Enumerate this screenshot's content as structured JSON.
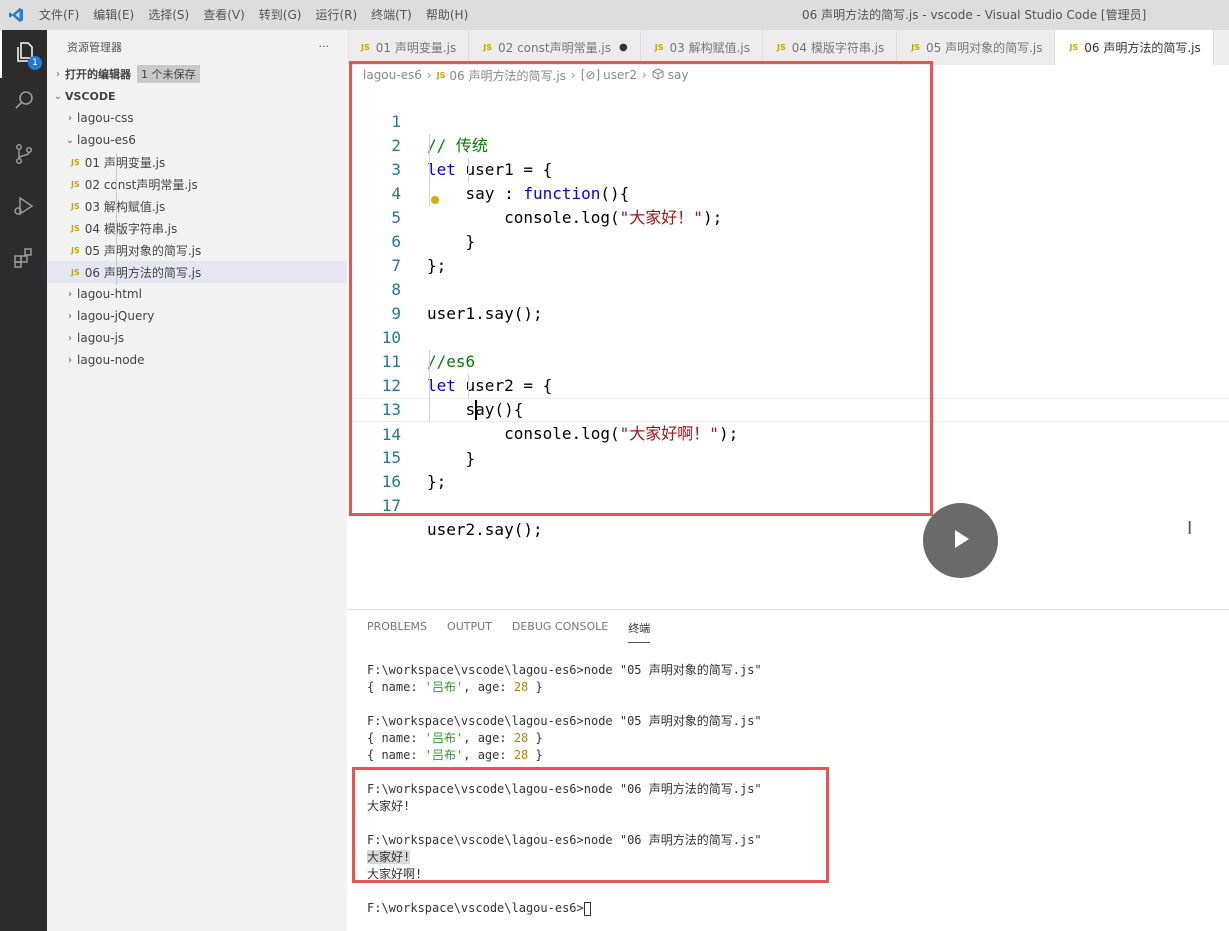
{
  "window": {
    "title": "06 声明方法的简写.js - vscode - Visual Studio Code [管理员]",
    "menu": [
      "文件(F)",
      "编辑(E)",
      "选择(S)",
      "查看(V)",
      "转到(G)",
      "运行(R)",
      "终端(T)",
      "帮助(H)"
    ]
  },
  "activity": {
    "explorer_badge": "1"
  },
  "sidebar": {
    "title": "资源管理器",
    "more": "···",
    "open_editors": {
      "label": "打开的编辑器",
      "badge": "1 个未保存"
    },
    "root": "VSCODE",
    "folders": {
      "css": "lagou-css",
      "es6": "lagou-es6",
      "html": "lagou-html",
      "jquery": "lagou-jQuery",
      "js": "lagou-js",
      "node": "lagou-node"
    },
    "files": [
      "01 声明变量.js",
      "02 const声明常量.js",
      "03 解构赋值.js",
      "04 模版字符串.js",
      "05 声明对象的简写.js",
      "06 声明方法的简写.js"
    ],
    "js_badge": "JS"
  },
  "tabs": [
    {
      "label": "01 声明变量.js"
    },
    {
      "label": "02 const声明常量.js",
      "dirty": "●"
    },
    {
      "label": "03 解构赋值.js"
    },
    {
      "label": "04 模版字符串.js"
    },
    {
      "label": "05 声明对象的简写.js"
    },
    {
      "label": "06 声明方法的简写.js"
    }
  ],
  "breadcrumb": {
    "folder": "lagou-es6",
    "file": "06 声明方法的简写.js",
    "symbol1_icon": "[⊘]",
    "symbol1": "user2",
    "symbol2": "say"
  },
  "editor": {
    "line_numbers": [
      "1",
      "2",
      "3",
      "4",
      "5",
      "6",
      "7",
      "8",
      "9",
      "10",
      "11",
      "12",
      "13",
      "14",
      "15",
      "16",
      "17"
    ],
    "l1": "// 传统",
    "l2_kw": "let",
    "l2_rest": " user1 = {",
    "l3_a": "    say : ",
    "l3_kw": "function",
    "l3_b": "(){",
    "l4_a": "        console.log(",
    "l4_str": "\"大家好！\"",
    "l4_b": ");",
    "l5": "    }",
    "l6": "};",
    "l8": "user1.say();",
    "l10": "//es6",
    "l11_kw": "let",
    "l11_rest": " user2 = {",
    "l12": "    say(){",
    "l13_a": "        console.log(",
    "l13_str": "\"大家好啊！\"",
    "l13_b": ");",
    "l14": "    }",
    "l15": "};",
    "l17": "user2.say();"
  },
  "panel": {
    "tabs": [
      "PROBLEMS",
      "OUTPUT",
      "DEBUG CONSOLE",
      "终端"
    ],
    "terminal": {
      "cmd05": "F:\\workspace\\vscode\\lagou-es6>node \"05 声明对象的简写.js\"",
      "obj_a": "{ name: ",
      "obj_name": "'吕布'",
      "obj_b": ", age: ",
      "obj_age": "28",
      "obj_c": " }",
      "cmd06": "F:\\workspace\\vscode\\lagou-es6>node \"06 声明方法的简写.js\"",
      "out1": "大家好!",
      "out2": "大家好啊!",
      "prompt": "F:\\workspace\\vscode\\lagou-es6>"
    }
  }
}
